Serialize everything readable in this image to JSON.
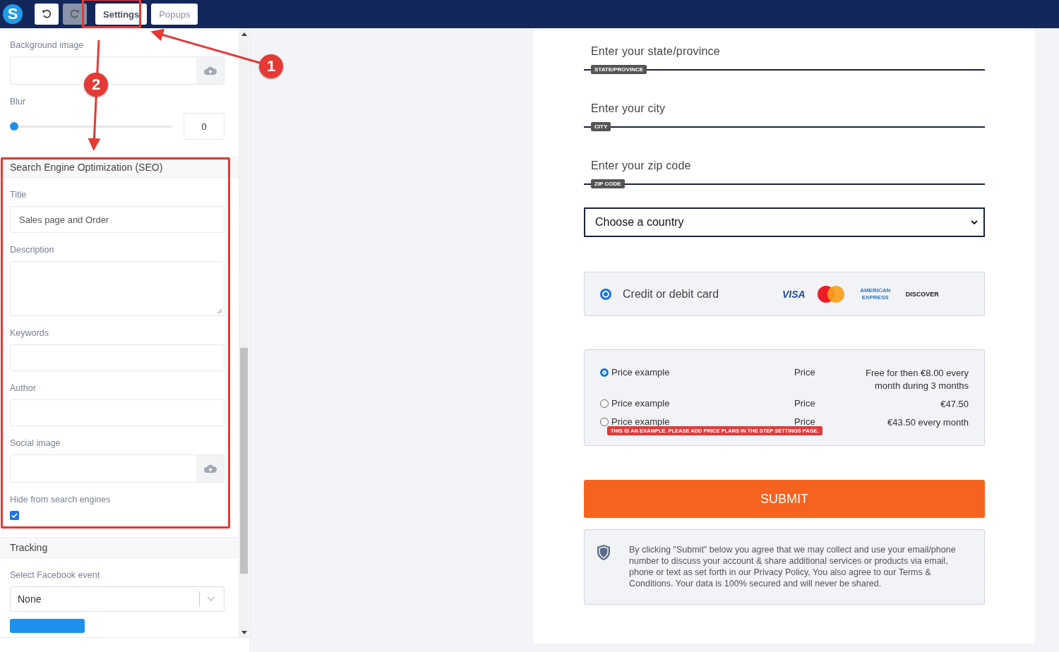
{
  "toolbar": {
    "logo": "S",
    "buttons": [
      {
        "kind": "undo",
        "disabled": false
      },
      {
        "kind": "redo",
        "disabled": true
      }
    ],
    "tabs": [
      {
        "label": "Settings",
        "selected": true
      },
      {
        "label": "Popups",
        "selected": false
      }
    ]
  },
  "sidebar": {
    "top_fields": [
      {
        "kind": "upload",
        "label": "Background image"
      },
      {
        "kind": "slider",
        "label": "Blur",
        "level": 0,
        "value": "0"
      }
    ],
    "sections": [
      {
        "title": "Search Engine Optimization (SEO)",
        "fields": [
          {
            "kind": "text",
            "label": "Title",
            "value": "Sales page and Order"
          },
          {
            "kind": "textarea",
            "label": "Description"
          },
          {
            "kind": "text",
            "label": "Keywords"
          },
          {
            "kind": "text",
            "label": "Author"
          },
          {
            "kind": "upload",
            "label": "Social image"
          },
          {
            "kind": "checkbox",
            "label": "Hide from search engines",
            "checked": true
          }
        ]
      },
      {
        "title": "Tracking",
        "fields": [
          {
            "kind": "select",
            "label": "Select Facebook event",
            "value": "None"
          },
          {
            "kind": "button"
          }
        ]
      }
    ]
  },
  "form": {
    "address_fields": [
      {
        "placeholder": "Enter your state/province",
        "tag": "STATE/PROVINCE"
      },
      {
        "placeholder": "Enter your city",
        "tag": "CITY"
      },
      {
        "placeholder": "Enter your zip code",
        "tag": "ZIP CODE"
      }
    ],
    "country": {
      "value": "Choose a country"
    },
    "payment": {
      "label": "Credit or debit card",
      "selected": true,
      "logos": [
        {
          "kind": "visa",
          "text": "VISA"
        },
        {
          "kind": "mastercard"
        },
        {
          "kind": "amex",
          "text": "AMERICAN EXPRESS"
        },
        {
          "kind": "discover",
          "text": "DISCOVER"
        }
      ]
    },
    "prices": [
      {
        "name": "Price example",
        "label": "Price",
        "amount": "Free for then €8.00 every month during 3 months",
        "selected": true
      },
      {
        "name": "Price example",
        "label": "Price",
        "amount": "€47.50",
        "selected": false
      },
      {
        "name": "Price example",
        "label": "Price",
        "amount": "€43.50 every month",
        "selected": false
      }
    ],
    "notice": "THIS IS AN EXAMPLE. PLEASE ADD PRICE PLANS IN THE STEP SETTINGS PAGE.",
    "submit": "SUBMIT",
    "disclaimer": "By clicking \"Submit\" below you agree that we may collect and use your email/phone number to discuss your account & share additional services or products via email, phone or text as set forth in our Privacy Policy, You also agree to our Terms & Conditions. Your data is 100% secured and will never be shared."
  },
  "callouts": [
    {
      "number": "1"
    },
    {
      "number": "2"
    }
  ]
}
